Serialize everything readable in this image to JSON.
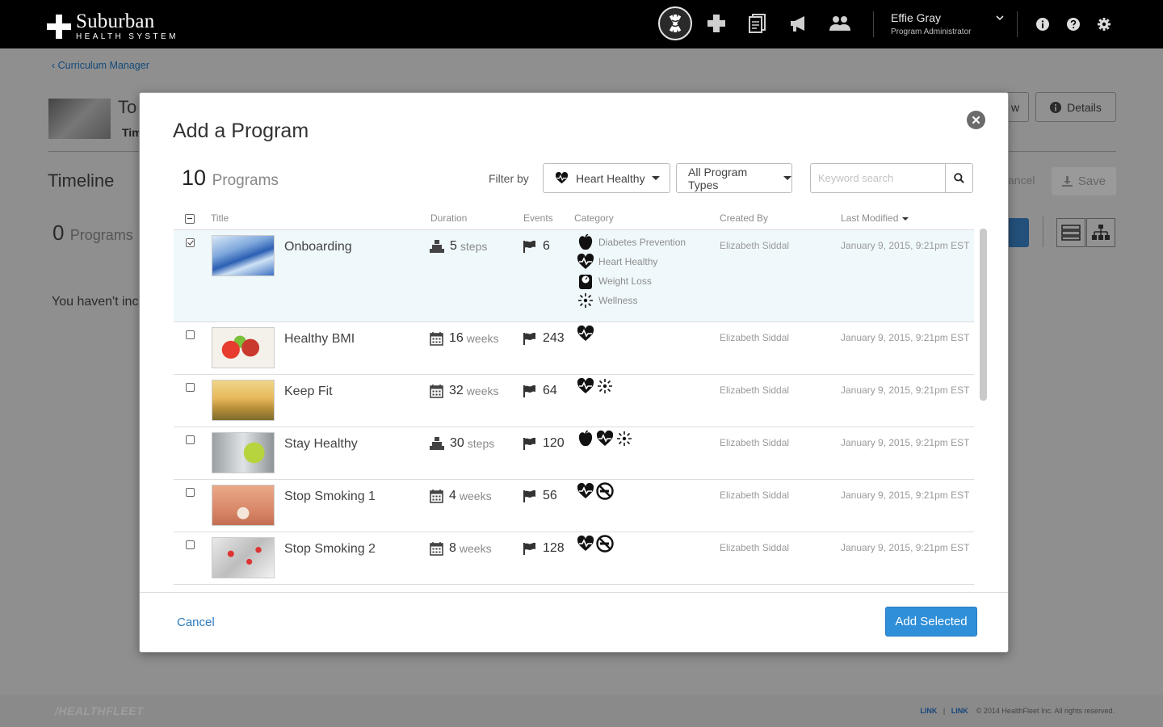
{
  "brand": {
    "name": "Suburban",
    "sub": "HEALTH SYSTEM"
  },
  "nav": {
    "icons": [
      "caduceus-icon",
      "medical-cross-icon",
      "documents-icon",
      "megaphone-icon",
      "users-icon"
    ],
    "active": "caduceus-icon"
  },
  "user": {
    "name": "Effie Gray",
    "role": "Program Administrator"
  },
  "utility_icons": [
    "info-icon",
    "help-icon",
    "settings-icon"
  ],
  "background_page": {
    "breadcrumb": "Curriculum Manager",
    "title": "To",
    "subtitle": "Tim",
    "timeline_label": "Timeline",
    "program_count": "0",
    "program_count_label": "Programs",
    "empty_message": "You haven't inc",
    "details_button": "Details",
    "new_button_fragment": "w",
    "cancel_fragment": "ancel",
    "save_button": "Save"
  },
  "modal": {
    "title": "Add a Program",
    "count": "10",
    "count_label": "Programs",
    "filter_label": "Filter by",
    "category_filter": "Heart Healthy",
    "type_filter": "All Program Types",
    "search_placeholder": "Keyword search",
    "columns": {
      "title": "Title",
      "duration": "Duration",
      "events": "Events",
      "category": "Category",
      "created_by": "Created By",
      "last_modified": "Last Modified"
    },
    "rows": [
      {
        "title": "Onboarding",
        "duration": "5",
        "duration_unit": "steps",
        "duration_icon": "steps-icon",
        "events": "6",
        "selected": true,
        "categories": [
          {
            "icon": "apple-icon",
            "label": "Diabetes Prevention"
          },
          {
            "icon": "heart-icon",
            "label": "Heart Healthy"
          },
          {
            "icon": "scale-icon",
            "label": "Weight Loss"
          },
          {
            "icon": "sun-icon",
            "label": "Wellness"
          }
        ],
        "created_by": "Elizabeth Siddal",
        "last_modified": "January 9, 2015, 9:21pm EST"
      },
      {
        "title": "Healthy BMI",
        "duration": "16",
        "duration_unit": "weeks",
        "duration_icon": "calendar-icon",
        "events": "243",
        "selected": false,
        "category_icons": [
          "heart-icon"
        ],
        "created_by": "Elizabeth Siddal",
        "last_modified": "January 9, 2015, 9:21pm EST"
      },
      {
        "title": "Keep Fit",
        "duration": "32",
        "duration_unit": "weeks",
        "duration_icon": "calendar-icon",
        "events": "64",
        "selected": false,
        "category_icons": [
          "heart-icon",
          "sun-icon"
        ],
        "created_by": "Elizabeth Siddal",
        "last_modified": "January 9, 2015, 9:21pm EST"
      },
      {
        "title": "Stay Healthy",
        "duration": "30",
        "duration_unit": "steps",
        "duration_icon": "steps-icon",
        "events": "120",
        "selected": false,
        "category_icons": [
          "apple-icon",
          "heart-icon",
          "sun-icon"
        ],
        "created_by": "Elizabeth Siddal",
        "last_modified": "January 9, 2015, 9:21pm EST"
      },
      {
        "title": "Stop Smoking 1",
        "duration": "4",
        "duration_unit": "weeks",
        "duration_icon": "calendar-icon",
        "events": "56",
        "selected": false,
        "category_icons": [
          "heart-icon",
          "no-smoking-icon"
        ],
        "created_by": "Elizabeth Siddal",
        "last_modified": "January 9, 2015, 9:21pm EST"
      },
      {
        "title": "Stop Smoking 2",
        "duration": "8",
        "duration_unit": "weeks",
        "duration_icon": "calendar-icon",
        "events": "128",
        "selected": false,
        "category_icons": [
          "heart-icon",
          "no-smoking-icon"
        ],
        "created_by": "Elizabeth Siddal",
        "last_modified": "January 9, 2015, 9:21pm EST"
      }
    ],
    "cancel_label": "Cancel",
    "add_label": "Add Selected"
  },
  "footer": {
    "logo": "/HEALTHFLEET",
    "link1": "LINK",
    "link2": "LINK",
    "copyright": "© 2014 HealthFleet Inc. All rights reserved."
  },
  "colors": {
    "primary_button": "#2f8fd8",
    "link": "#2d7bbf",
    "selected_row": "#eff8fb",
    "topbar": "#000000"
  }
}
